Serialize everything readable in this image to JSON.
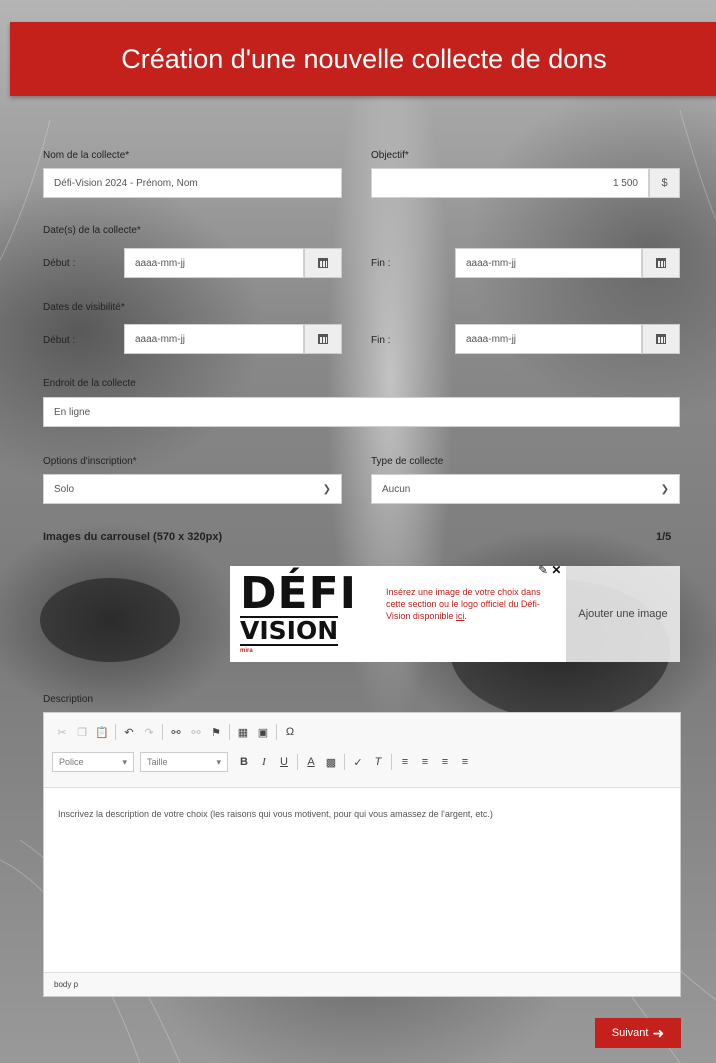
{
  "header": {
    "title": "Création d'une nouvelle collecte de dons"
  },
  "form": {
    "name_label": "Nom de la collecte*",
    "name_value": "Défi-Vision 2024 - Prénom, Nom",
    "goal_label": "Objectif*",
    "goal_value": "1 500",
    "goal_currency": "$",
    "dates_label": "Date(s) de la collecte*",
    "visibility_label": "Dates de visibilité*",
    "start_label": "Début :",
    "end_label": "Fin :",
    "date_placeholder": "aaaa-mm-jj",
    "location_label": "Endroit de la collecte",
    "location_value": "En ligne",
    "registration_label": "Options d'inscription*",
    "registration_value": "Solo",
    "type_label": "Type de collecte",
    "type_value": "Aucun"
  },
  "carousel": {
    "title": "Images du carrousel (570 x 320px)",
    "count": "1/5",
    "logo_line1": "DÉFI",
    "logo_line2": "VISION",
    "logo_brand": "mira",
    "card_text": "Insérez une image de votre choix dans cette section ou le logo officiel du Défi-Vision disponible",
    "card_link": "ici",
    "add_image_label": "Ajouter une image"
  },
  "description": {
    "label": "Description",
    "font_combo": "Police",
    "size_combo": "Taille",
    "placeholder_text": "Inscrivez la description de votre choix (les raisons qui vous motivent, pour qui vous amassez de l'argent, etc.)",
    "path": "body  p"
  },
  "actions": {
    "next_label": "Suivant"
  },
  "colors": {
    "brand_red": "#c4201c"
  }
}
